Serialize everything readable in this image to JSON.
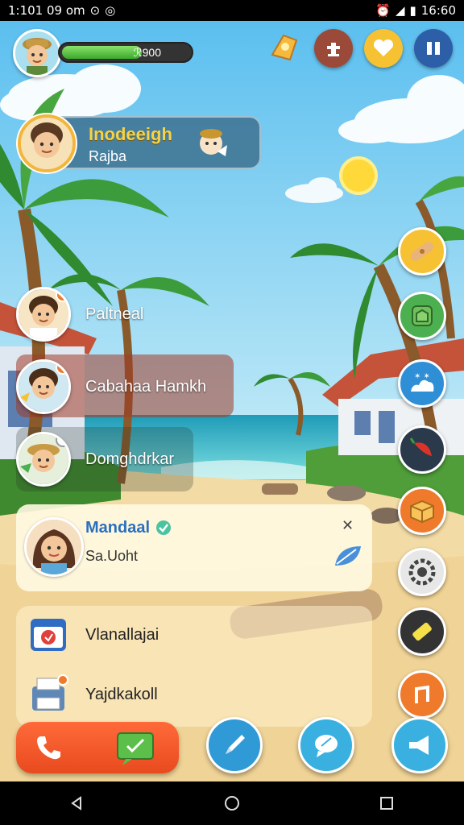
{
  "status_bar": {
    "time_left": "1:101 09 om",
    "time_right": "16:60"
  },
  "profile": {
    "xp_label": "ℛ900",
    "xp_progress": 0.62
  },
  "banner": {
    "title": "Inodeeigh",
    "subtitle": "Rajba"
  },
  "contacts": [
    {
      "name": "Paltneal"
    },
    {
      "name": "Cabahaa Hamkh"
    },
    {
      "name": "Domghdrkar"
    }
  ],
  "selected_chat": {
    "title": "Mandaal",
    "subtitle": "Sa.Uoht"
  },
  "list_items": [
    {
      "label": "Vlanallajai"
    },
    {
      "label": "Yajdkakoll"
    }
  ],
  "icons": {
    "top": [
      "trophy-icon",
      "upgrade-icon",
      "heart-icon",
      "pause-icon"
    ],
    "side": [
      "bandage-icon",
      "map-icon",
      "weather-icon",
      "pepper-icon",
      "box-icon",
      "settings-icon",
      "battery-icon",
      "music-icon"
    ],
    "bottom": [
      "phone-icon",
      "chat-icon",
      "pen-icon",
      "message-icon",
      "megaphone-icon"
    ]
  },
  "colors": {
    "accent_orange": "#f07a2b",
    "sky": "#8fd3f4",
    "sand": "#f3dba5",
    "sea": "#2fb5c8",
    "green": "#4caf50"
  }
}
